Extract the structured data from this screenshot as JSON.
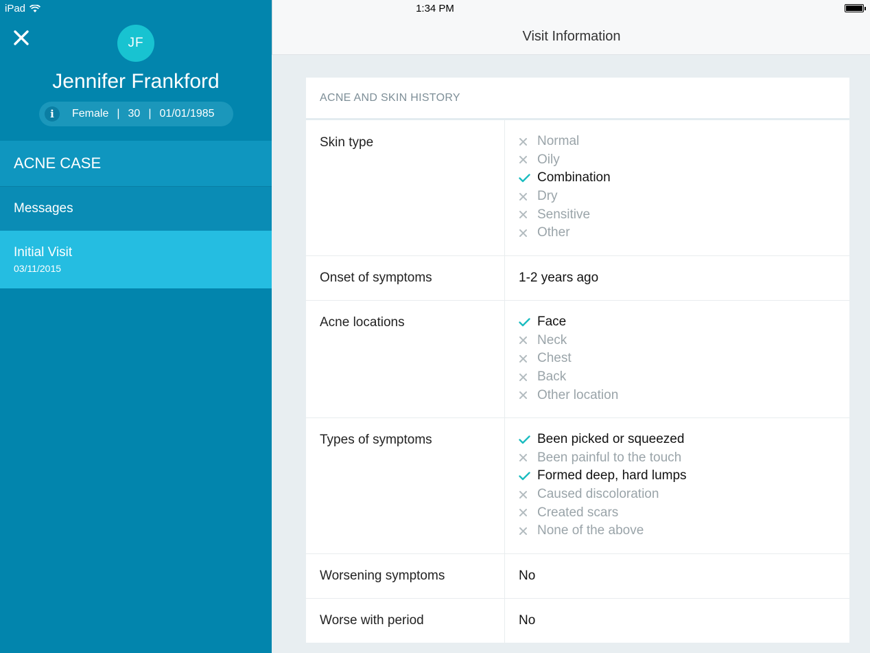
{
  "status_bar": {
    "device": "iPad",
    "time": "1:34 PM"
  },
  "patient": {
    "initials": "JF",
    "name": "Jennifer Frankford",
    "gender": "Female",
    "age": "30",
    "dob": "01/01/1985",
    "sep": "|"
  },
  "sidebar": {
    "case_title": "ACNE CASE",
    "messages_label": "Messages",
    "visit_label": "Initial Visit",
    "visit_date": "03/11/2015"
  },
  "header": {
    "title": "Visit Information"
  },
  "section": {
    "title": "ACNE AND SKIN HISTORY",
    "rows": [
      {
        "label": "Skin type",
        "options": [
          {
            "text": "Normal",
            "checked": false
          },
          {
            "text": "Oily",
            "checked": false
          },
          {
            "text": "Combination",
            "checked": true
          },
          {
            "text": "Dry",
            "checked": false
          },
          {
            "text": "Sensitive",
            "checked": false
          },
          {
            "text": "Other",
            "checked": false
          }
        ]
      },
      {
        "label": "Onset of symptoms",
        "value": "1-2 years ago"
      },
      {
        "label": "Acne locations",
        "options": [
          {
            "text": "Face",
            "checked": true
          },
          {
            "text": "Neck",
            "checked": false
          },
          {
            "text": "Chest",
            "checked": false
          },
          {
            "text": "Back",
            "checked": false
          },
          {
            "text": "Other location",
            "checked": false
          }
        ]
      },
      {
        "label": "Types of symptoms",
        "options": [
          {
            "text": "Been picked or squeezed",
            "checked": true
          },
          {
            "text": "Been painful to the touch",
            "checked": false
          },
          {
            "text": "Formed deep, hard lumps",
            "checked": true
          },
          {
            "text": "Caused discoloration",
            "checked": false
          },
          {
            "text": "Created scars",
            "checked": false
          },
          {
            "text": "None of the above",
            "checked": false
          }
        ]
      },
      {
        "label": "Worsening symptoms",
        "value": "No"
      },
      {
        "label": "Worse with period",
        "value": "No"
      }
    ]
  },
  "colors": {
    "check": "#1bbcc0",
    "cross": "#b3bcc0",
    "sidebar": "#0285ad",
    "avatar": "#18c3d1"
  }
}
